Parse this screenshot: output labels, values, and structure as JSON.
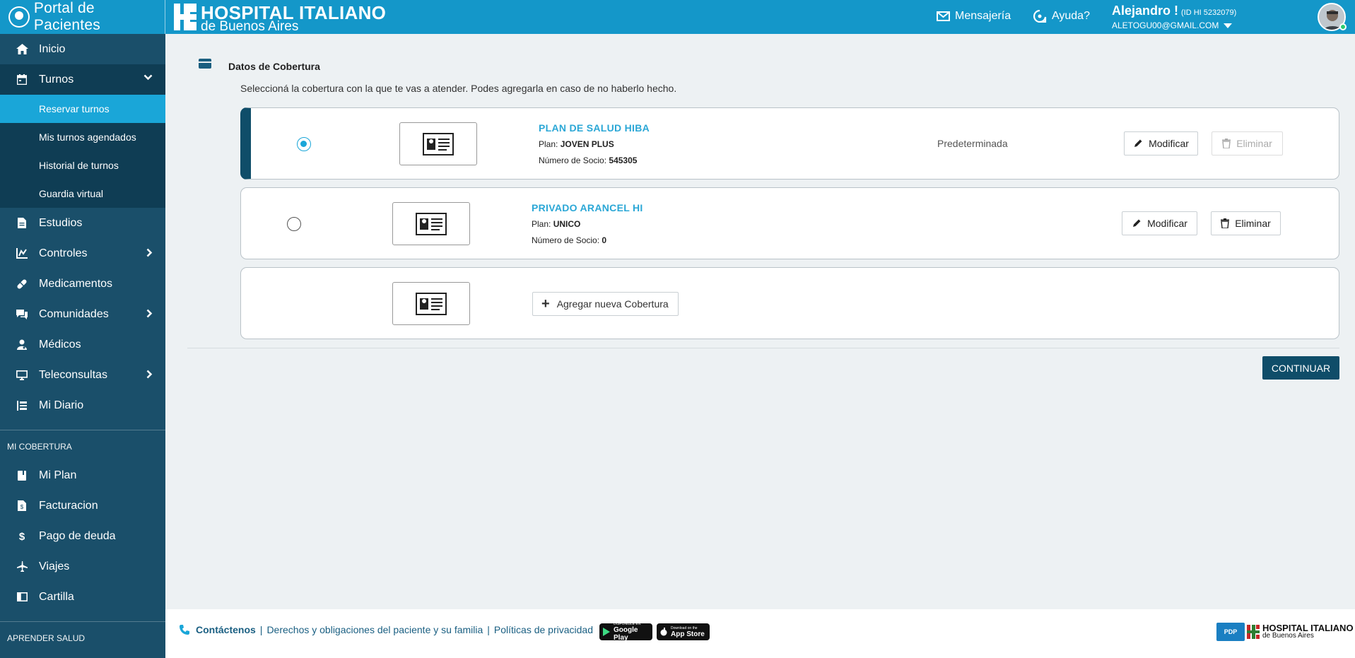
{
  "header": {
    "portal_title": "Portal de Pacientes",
    "hospital_line1": "HOSPITAL ITALIANO",
    "hospital_line2": "de Buenos Aires",
    "messaging_label": "Mensajería",
    "help_label": "Ayuda?",
    "user_name": "Alejandro !",
    "user_id": "(ID HI 5232079)",
    "user_email": "ALETOGU00@GMAIL.COM"
  },
  "sidebar": {
    "items": [
      {
        "label": "Inicio",
        "icon": "home-icon"
      },
      {
        "label": "Turnos",
        "icon": "calendar-icon"
      },
      {
        "label": "Estudios",
        "icon": "document-icon"
      },
      {
        "label": "Controles",
        "icon": "scale-icon"
      },
      {
        "label": "Medicamentos",
        "icon": "pill-icon"
      },
      {
        "label": "Comunidades",
        "icon": "chat-icon"
      },
      {
        "label": "Médicos",
        "icon": "doctor-icon"
      },
      {
        "label": "Teleconsultas",
        "icon": "monitor-icon"
      },
      {
        "label": "Mi Diario",
        "icon": "diary-icon"
      }
    ],
    "turnos_sub": [
      {
        "label": "Reservar turnos"
      },
      {
        "label": "Mis turnos agendados"
      },
      {
        "label": "Historial de turnos"
      },
      {
        "label": "Guardia virtual"
      }
    ],
    "section_cobertura": "MI COBERTURA",
    "cobertura_items": [
      {
        "label": "Mi Plan",
        "icon": "book-icon"
      },
      {
        "label": "Facturacion",
        "icon": "invoice-icon"
      },
      {
        "label": "Pago de deuda",
        "icon": "dollar-icon"
      },
      {
        "label": "Viajes",
        "icon": "plane-icon"
      },
      {
        "label": "Cartilla",
        "icon": "directory-icon"
      }
    ],
    "section_aprender": "APRENDER SALUD"
  },
  "main": {
    "section_title": "Datos de Cobertura",
    "description": "Seleccioná la cobertura con la que te vas a atender. Podes agregarla en caso de no haberlo hecho.",
    "coverages": [
      {
        "name": "PLAN DE SALUD HIBA",
        "plan_label": "Plan:",
        "plan": "JOVEN PLUS",
        "member_label": "Número de Socio:",
        "member": "545305",
        "status": "Predeterminada",
        "selected": true
      },
      {
        "name": "PRIVADO ARANCEL HI",
        "plan_label": "Plan:",
        "plan": "UNICO",
        "member_label": "Número de Socio:",
        "member": "0",
        "status": "",
        "selected": false
      }
    ],
    "modify_label": "Modificar",
    "delete_label": "Eliminar",
    "add_label": "Agregar nueva Cobertura",
    "continue_label": "CONTINUAR"
  },
  "footer": {
    "contact": "Contáctenos",
    "rights": "Derechos y obligaciones del paciente y su familia",
    "privacy": "Políticas de privacidad",
    "google_small": "DISPONIBLE EN",
    "google_big": "Google Play",
    "apple_small": "Download on the",
    "apple_big": "App Store",
    "pdp": "PDP",
    "hospital_line1": "HOSPITAL ITALIANO",
    "hospital_line2": "de Buenos Aires"
  },
  "colors": {
    "topbar": "#1497c9",
    "sidebar": "#1a4f6a",
    "active_sub": "#1aa6d8",
    "accent_dark": "#0f4d69",
    "plan_name": "#2ba7d6"
  }
}
